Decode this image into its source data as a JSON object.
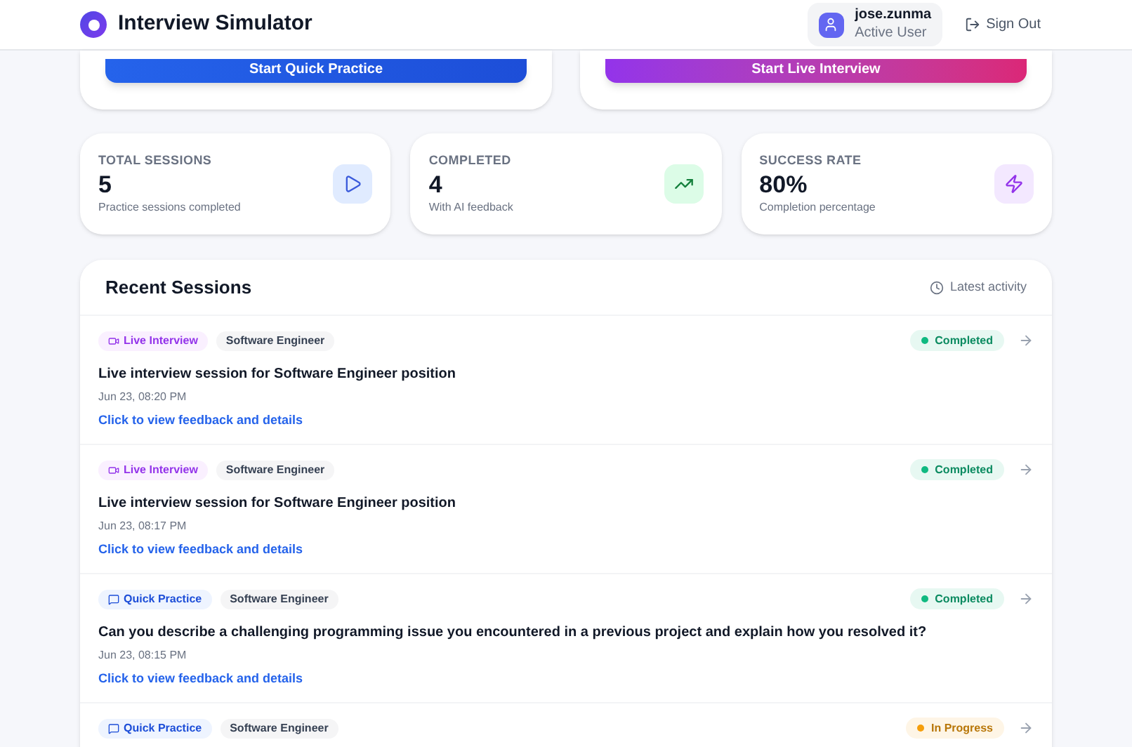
{
  "header": {
    "title": "Interview Simulator",
    "user": {
      "name": "jose.zunma",
      "role": "Active User"
    },
    "sign_out": "Sign Out"
  },
  "actions": [
    {
      "kind": "quick",
      "label": "Start Quick Practice"
    },
    {
      "kind": "live",
      "label": "Start Live Interview"
    }
  ],
  "stats": [
    {
      "kind": "play",
      "label": "TOTAL SESSIONS",
      "value": "5",
      "caption": "Practice sessions completed"
    },
    {
      "kind": "trend",
      "label": "COMPLETED",
      "value": "4",
      "caption": "With AI feedback"
    },
    {
      "kind": "bolt",
      "label": "SUCCESS RATE",
      "value": "80%",
      "caption": "Completion percentage"
    }
  ],
  "recent": {
    "title": "Recent Sessions",
    "hint": "Latest activity",
    "sessions": [
      {
        "kind": "live",
        "type_label": "Live Interview",
        "role": "Software Engineer",
        "color": "#10b981",
        "status": "Completed",
        "title": "Live interview session for Software Engineer position",
        "date": "Jun 23, 08:20 PM",
        "link": "Click to view feedback and details"
      },
      {
        "kind": "live",
        "type_label": "Live Interview",
        "role": "Software Engineer",
        "color": "#10b981",
        "status": "Completed",
        "title": "Live interview session for Software Engineer position",
        "date": "Jun 23, 08:17 PM",
        "link": "Click to view feedback and details"
      },
      {
        "kind": "quick",
        "type_label": "Quick Practice",
        "role": "Software Engineer",
        "color": "#10b981",
        "status": "Completed",
        "title": "Can you describe a challenging programming issue you encountered in a previous project and explain how you resolved it?",
        "date": "Jun 23, 08:15 PM",
        "link": "Click to view feedback and details"
      },
      {
        "kind": "quick",
        "type_label": "Quick Practice",
        "role": "Software Engineer",
        "color": "#f59e0b",
        "status": "In Progress"
      }
    ]
  }
}
